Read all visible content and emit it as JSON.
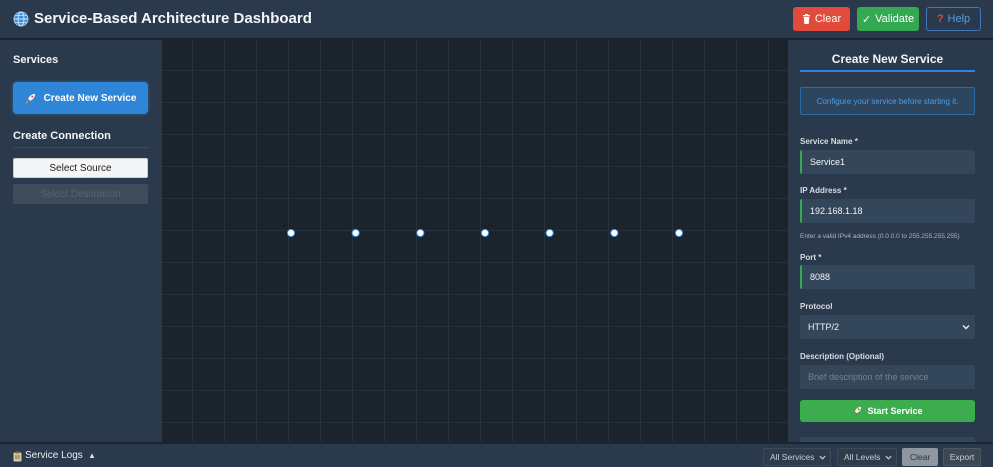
{
  "header": {
    "title": "Service-Based Architecture Dashboard",
    "icon": "globe-icon",
    "clear_label": "Clear",
    "validate_label": "Validate",
    "help_label": "Help",
    "clear_icon": "trash-icon",
    "validate_icon": "✓",
    "help_icon": "?"
  },
  "sidebar": {
    "services_title": "Services",
    "create_service_label": "Create New Service",
    "create_service_icon": "rocket-icon",
    "connection_title": "Create Connection",
    "select_source_label": "Select Source",
    "select_destination_label": "Select Destination"
  },
  "canvas": {
    "connection_points": 7
  },
  "panel": {
    "title": "Create New Service",
    "info_text": "Configure your service before starting it.",
    "service_name_label": "Service Name *",
    "service_name_value": "Service1",
    "ip_label": "IP Address *",
    "ip_value": "192.168.1.18",
    "ip_hint": "Enter a valid IPv4 address (0.0.0.0 to 255.255.255.255)",
    "port_label": "Port *",
    "port_value": "8088",
    "protocol_label": "Protocol",
    "protocol_value": "HTTP/2",
    "description_label": "Description (Optional)",
    "description_placeholder": "Brief description of the service",
    "start_label": "Start Service",
    "start_icon": "rocket-icon"
  },
  "footer": {
    "logs_title": "Service Logs",
    "logs_icon": "clipboard-icon",
    "caret": "▲",
    "services_filter": "All Services",
    "levels_filter": "All Levels",
    "clear_label": "Clear",
    "export_label": "Export"
  },
  "colors": {
    "accent": "#2f86d8",
    "success": "#35a852",
    "danger": "#e04b3c",
    "panel_bg": "#2a3a4c",
    "canvas_bg": "#1b232c"
  }
}
